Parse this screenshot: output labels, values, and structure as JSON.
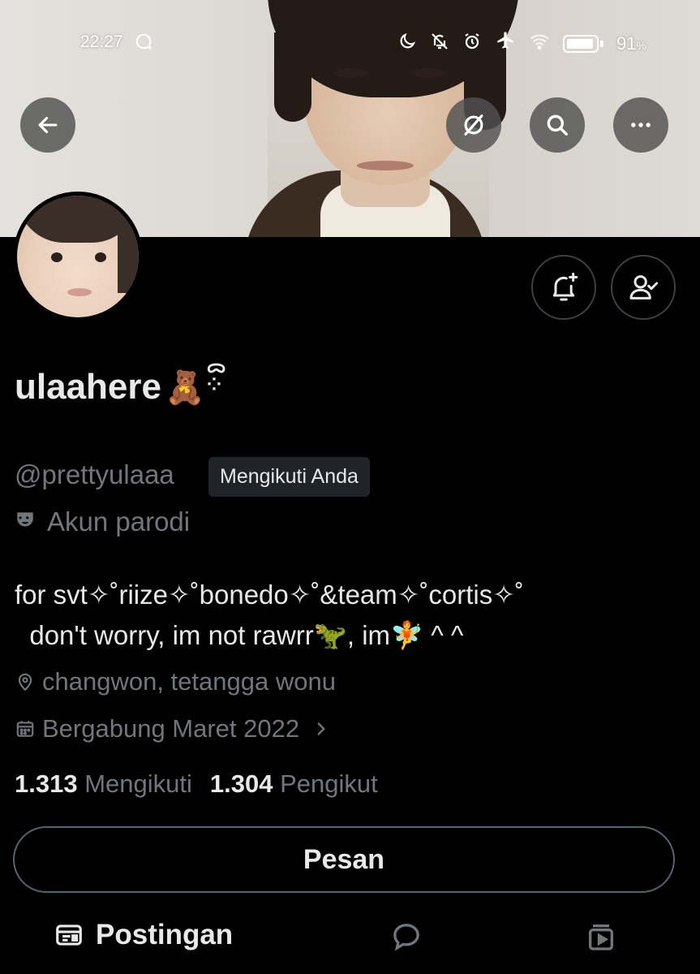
{
  "status_bar": {
    "time": "22:27",
    "battery_percent": "91",
    "battery_suffix": "%"
  },
  "top_buttons": [
    "back-icon",
    "hide-icon",
    "search-icon",
    "more-icon"
  ],
  "profile": {
    "display_name": "ulaahere",
    "name_emoji": "🧸",
    "name_deco": "ᯅ\n⁘",
    "handle": "@prettyulaaa",
    "follows_you": "Mengikuti Anda",
    "parody_label": "Akun parodi",
    "bio_line1": "for svt✧˚riize✧˚bonedo✧˚&team✧˚cortis✧˚",
    "bio_line2": "  don't worry, im not rawrr🦖, im🧚 ^ ^",
    "location": "changwon, tetangga wonu",
    "joined": "Bergabung Maret 2022",
    "following_count": "1.313",
    "following_label": "Mengikuti",
    "followers_count": "1.304",
    "followers_label": "Pengikut",
    "message_button": "Pesan"
  },
  "tabs": {
    "posts_label": "Postingan"
  },
  "colors": {
    "background": "#000000",
    "text_primary": "#e7e9ea",
    "text_secondary": "#71767b",
    "badge_bg": "#202327"
  }
}
